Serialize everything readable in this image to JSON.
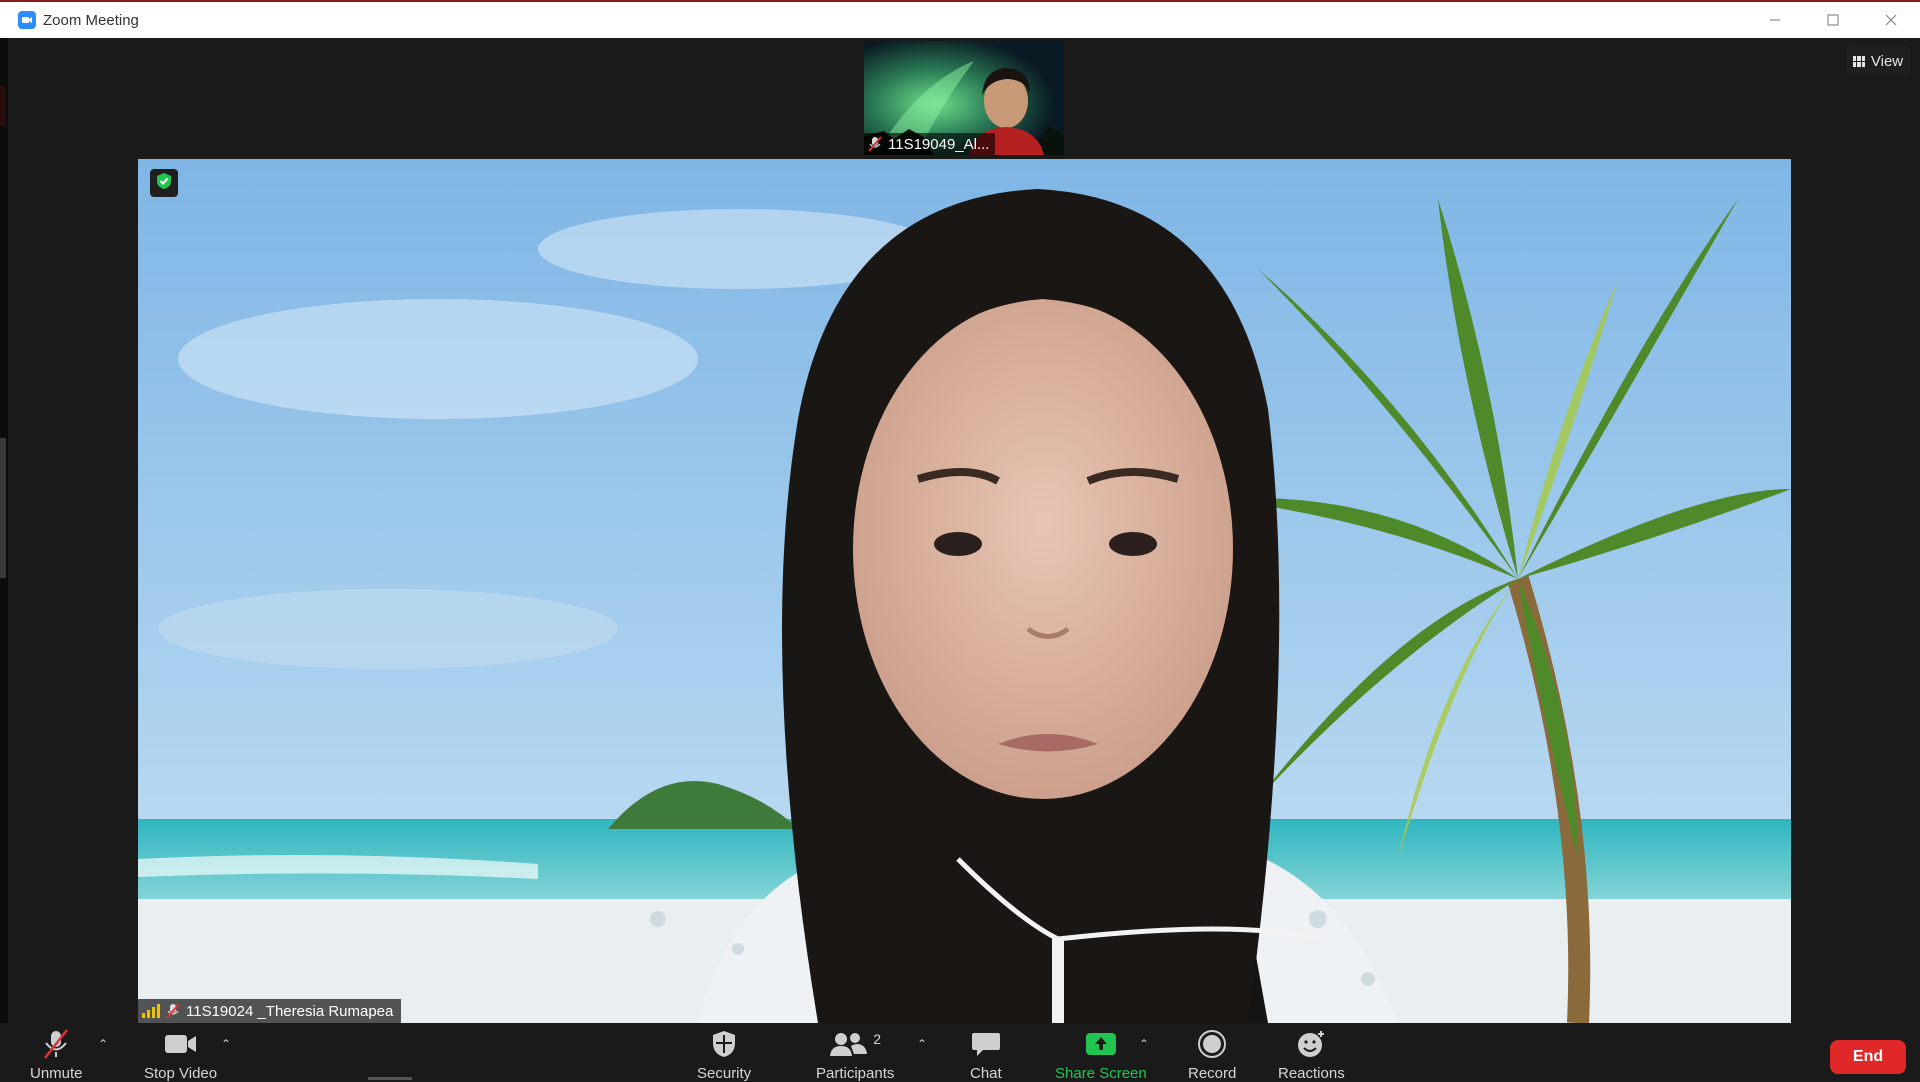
{
  "window": {
    "title": "Zoom Meeting",
    "icon": "zoom-camera-icon"
  },
  "header": {
    "view_label": "View",
    "view_icon": "grid-icon"
  },
  "thumbnail": {
    "name": "11S19049_Al...",
    "muted": true
  },
  "main": {
    "participant_name": "11S19024 _Theresia Rumapea",
    "muted": true,
    "encryption_icon": "shield-check-icon"
  },
  "toolbar": {
    "unmute_label": "Unmute",
    "stop_video_label": "Stop Video",
    "security_label": "Security",
    "participants_label": "Participants",
    "participants_count": "2",
    "chat_label": "Chat",
    "share_screen_label": "Share Screen",
    "record_label": "Record",
    "reactions_label": "Reactions",
    "end_label": "End"
  },
  "colors": {
    "accent": "#2d8cff",
    "share_green": "#23c552",
    "end_red": "#e02828",
    "toolbar_bg": "#1a1a1a"
  }
}
